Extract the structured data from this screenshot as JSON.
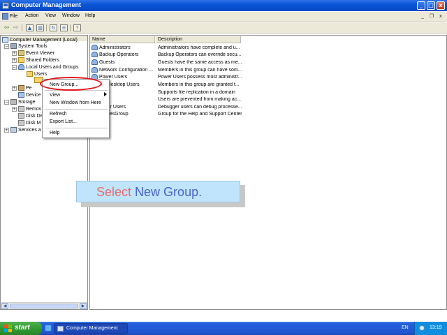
{
  "window": {
    "title": "Computer Management",
    "controls": {
      "minimize": "_",
      "maximize": "□",
      "close": "x"
    }
  },
  "menubar": {
    "items": [
      "File",
      "Action",
      "View",
      "Window",
      "Help"
    ],
    "window_controls": {
      "minimize": "_",
      "restore": "❐",
      "close": "x"
    }
  },
  "tree": {
    "items": [
      {
        "label": "Computer Management (Local)",
        "icon": "computer-icon"
      },
      {
        "label": "System Tools",
        "icon": "tools-icon"
      },
      {
        "label": "Event Viewer",
        "icon": "event-viewer-icon"
      },
      {
        "label": "Shared Folders",
        "icon": "folder-icon"
      },
      {
        "label": "Local Users and Groups",
        "icon": "users-icon"
      },
      {
        "label": "Users",
        "icon": "folder-icon"
      },
      {
        "label": "Pe",
        "icon": "performance-icon"
      },
      {
        "label": "Device",
        "icon": "device-icon"
      },
      {
        "label": "Storage",
        "icon": "storage-icon"
      },
      {
        "label": "Remov",
        "icon": "disk-icon"
      },
      {
        "label": "Disk De",
        "icon": "disk-icon"
      },
      {
        "label": "Disk M",
        "icon": "disk-icon"
      },
      {
        "label": "Services a",
        "icon": "services-icon"
      }
    ]
  },
  "list": {
    "columns": {
      "name": "Name",
      "description": "Description"
    },
    "rows": [
      {
        "name": "Administrators",
        "description": "Administrators have complete and u..."
      },
      {
        "name": "Backup Operators",
        "description": "Backup Operators can override secu..."
      },
      {
        "name": "Guests",
        "description": "Guests have the same access as me..."
      },
      {
        "name": "Network Configuration ...",
        "description": "Members in this group can have som..."
      },
      {
        "name": "Power Users",
        "description": "Power Users possess most administr..."
      },
      {
        "name": "ote Desktop Users",
        "description": "Members in this group are granted t..."
      },
      {
        "name": "cator",
        "description": "Supports file replication in a domain"
      },
      {
        "name": "",
        "description": "Users are prevented from making ac..."
      },
      {
        "name": "ugger Users",
        "description": "Debugger users can debug processe..."
      },
      {
        "name": "ervicesGroup",
        "description": "Group for the Help and Support Center"
      }
    ]
  },
  "context_menu": {
    "new_group": "New Group...",
    "view": "View",
    "new_window": "New Window from Here",
    "refresh": "Refresh",
    "export": "Export List...",
    "help": "Help"
  },
  "caption": {
    "word1": "Select",
    "word2": "New Group."
  },
  "taskbar": {
    "start": "start",
    "task_label": "Computer Management",
    "language": "EN",
    "clock": "13:19"
  },
  "colors": {
    "titlebar": "#0a55d8",
    "highlight_ellipse": "#e0161b",
    "caption_bg": "#bfe4fb",
    "caption_word1": "#ea6a6a",
    "caption_word2": "#4a64c9",
    "taskbar": "#245edb",
    "start_button": "#2f962f"
  }
}
